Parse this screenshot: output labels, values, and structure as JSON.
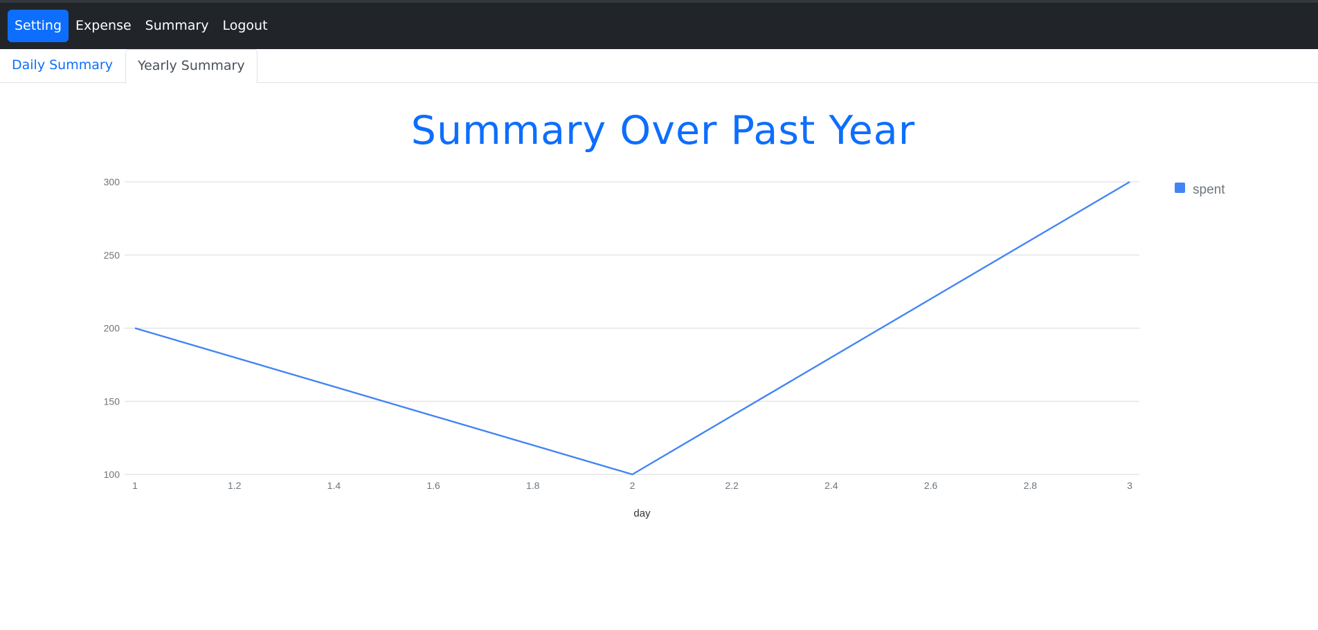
{
  "nav": {
    "items": [
      {
        "label": "Setting",
        "active": true
      },
      {
        "label": "Expense",
        "active": false
      },
      {
        "label": "Summary",
        "active": false
      },
      {
        "label": "Logout",
        "active": false
      }
    ]
  },
  "tabs": {
    "daily": "Daily Summary",
    "yearly": "Yearly Summary"
  },
  "colors": {
    "accent": "#0d6efd",
    "series": "#4285f4",
    "navbar": "#212529"
  },
  "chart_data": {
    "type": "line",
    "title": "Summary Over Past Year",
    "xlabel": "day",
    "ylabel": "",
    "x": [
      1,
      2,
      3
    ],
    "series": [
      {
        "name": "spent",
        "values": [
          200,
          100,
          300
        ]
      }
    ],
    "xlim": [
      1,
      3
    ],
    "ylim": [
      100,
      300
    ],
    "xticks": [
      1,
      1.2,
      1.4,
      1.6,
      1.8,
      2,
      2.2,
      2.4,
      2.6,
      2.8,
      3
    ],
    "yticks": [
      100,
      150,
      200,
      250,
      300
    ],
    "grid": true,
    "legend": "right"
  }
}
